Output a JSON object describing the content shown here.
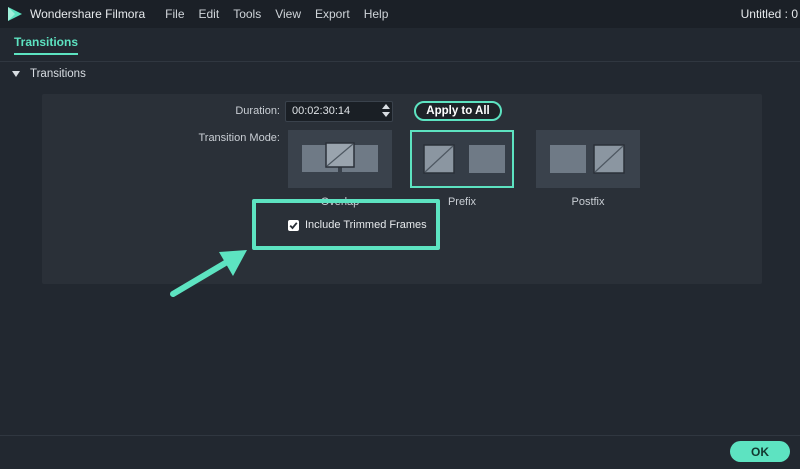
{
  "app": {
    "name": "Wondershare Filmora",
    "window_title": "Untitled : 0",
    "logo_icon": "filmora-logo-icon"
  },
  "menu": [
    "File",
    "Edit",
    "Tools",
    "View",
    "Export",
    "Help"
  ],
  "tab": {
    "label": "Transitions"
  },
  "section": {
    "title": "Transitions"
  },
  "duration": {
    "label": "Duration:",
    "value": "00:02:30:14"
  },
  "apply_button": {
    "label": "Apply to All"
  },
  "transition_mode": {
    "label": "Transition Mode:",
    "options": [
      {
        "label": "Overlap",
        "selected": false
      },
      {
        "label": "Prefix",
        "selected": true
      },
      {
        "label": "Postfix",
        "selected": false
      }
    ]
  },
  "include_trimmed": {
    "label": "Include Trimmed Frames",
    "checked": true
  },
  "ok_button": {
    "label": "OK"
  },
  "colors": {
    "accent": "#5de3c1",
    "background": "#222830",
    "panel": "#2a3038",
    "titlebar": "#1b2027"
  }
}
